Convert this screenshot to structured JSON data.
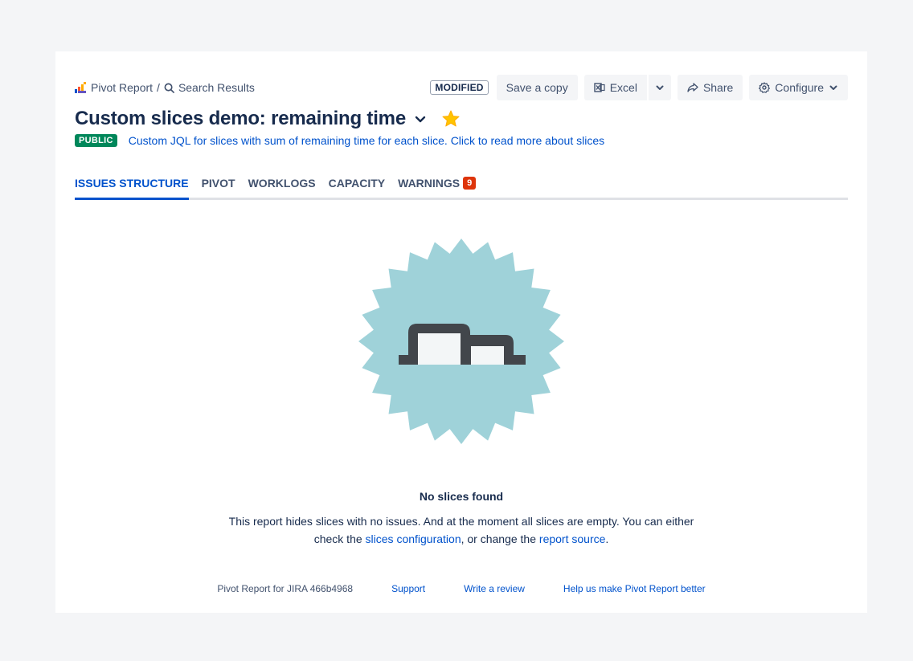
{
  "breadcrumb": {
    "app_label": "Pivot Report",
    "separator": "/",
    "search_label": "Search Results"
  },
  "status": {
    "modified": "MODIFIED"
  },
  "toolbar": {
    "save_copy": "Save a copy",
    "excel": "Excel",
    "share": "Share",
    "configure": "Configure"
  },
  "report": {
    "title": "Custom slices demo: remaining time",
    "visibility": "PUBLIC",
    "description": "Custom JQL for slices with sum of remaining time for each slice. Click to read more about slices",
    "favorite_color": "#ffc400"
  },
  "tabs": [
    {
      "label": "ISSUES STRUCTURE",
      "active": true
    },
    {
      "label": "PIVOT"
    },
    {
      "label": "WORKLOGS"
    },
    {
      "label": "CAPACITY"
    },
    {
      "label": "WARNINGS",
      "badge": "9"
    }
  ],
  "empty_state": {
    "title": "No slices found",
    "text_1": "This report hides slices with no issues. And at the moment all slices are empty. You can either check the ",
    "link_1": "slices configuration",
    "text_2": ", or change the ",
    "link_2": "report source",
    "text_3": "."
  },
  "footer": {
    "version": "Pivot Report for JIRA 466b4968",
    "support": "Support",
    "review": "Write a review",
    "feedback": "Help us make Pivot Report better"
  },
  "colors": {
    "accent": "#0052cc",
    "public_green": "#00875a",
    "badge_red": "#de350b",
    "illustration_teal": "#9fd2d9"
  }
}
